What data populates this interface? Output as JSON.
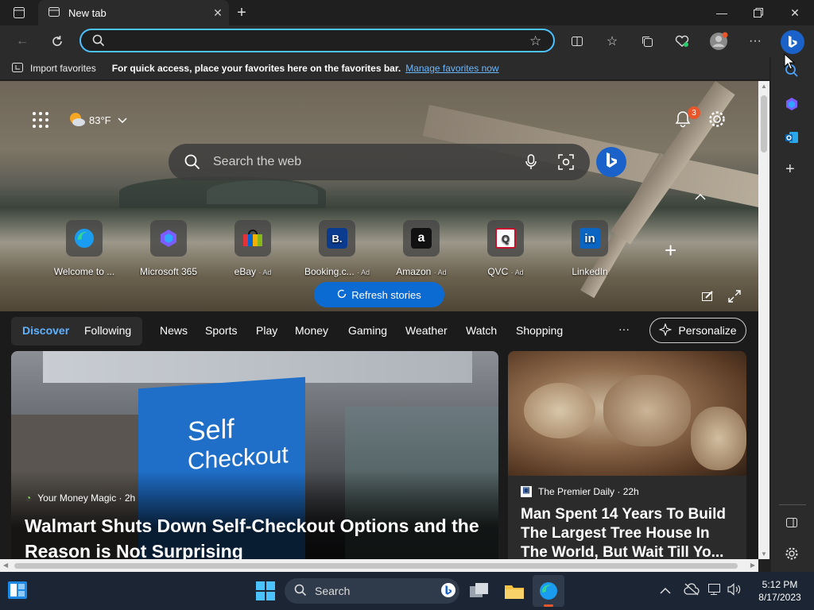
{
  "browser": {
    "tab_title": "New tab",
    "address_value": "",
    "favorites_bar": {
      "import_label": "Import favorites",
      "message": "For quick access, place your favorites here on the favorites bar.",
      "manage_link": "Manage favorites now"
    }
  },
  "newtab": {
    "weather": "83°F",
    "notifications_count": "3",
    "search_placeholder": "Search the web",
    "quick_links": [
      {
        "label": "Welcome to ...",
        "ad": "",
        "icon": "edge-icon"
      },
      {
        "label": "Microsoft 365",
        "ad": "",
        "icon": "m365-icon"
      },
      {
        "label": "eBay",
        "ad": "· Ad",
        "icon": "ebay-icon"
      },
      {
        "label": "Booking.c...",
        "ad": "· Ad",
        "icon": "booking-icon"
      },
      {
        "label": "Amazon",
        "ad": "· Ad",
        "icon": "amazon-icon"
      },
      {
        "label": "QVC",
        "ad": "· Ad",
        "icon": "qvc-icon"
      },
      {
        "label": "LinkedIn",
        "ad": "",
        "icon": "linkedin-icon"
      }
    ],
    "nav": {
      "items": [
        "Discover",
        "Following",
        "News",
        "Sports",
        "Play",
        "Money",
        "Gaming",
        "Weather",
        "Watch",
        "Shopping"
      ],
      "more": "···",
      "personalize": "Personalize"
    },
    "refresh_label": "Refresh stories",
    "cards": [
      {
        "source": "Your Money Magic · 2h",
        "headline": "Walmart Shuts Down Self-Checkout Options and the Reason is Not Surprising",
        "image_text": [
          "Self",
          "Checkout"
        ]
      },
      {
        "source": "The Premier Daily · 22h",
        "headline": "Man Spent 14 Years To Build The Largest Tree House In The World, But Wait Till Yo..."
      }
    ]
  },
  "taskbar": {
    "search_label": "Search",
    "time": "5:12 PM",
    "date": "8/17/2023"
  },
  "colors": {
    "accent": "#4cc2ff",
    "discover": "#5fb2ff",
    "link": "#6cb8ff",
    "refresh_bg": "#0b6bd3",
    "badge": "#e8572b"
  }
}
